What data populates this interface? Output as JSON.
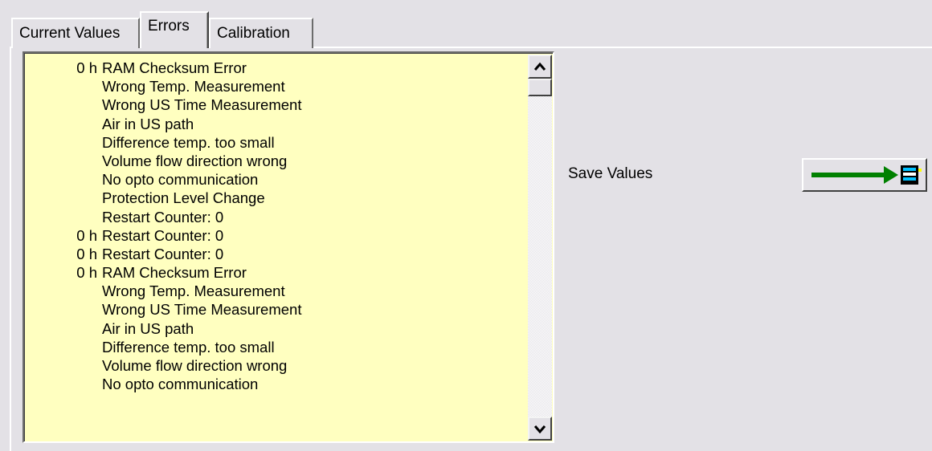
{
  "tabs": [
    {
      "label": "Current Values",
      "active": false
    },
    {
      "label": "Errors",
      "active": true
    },
    {
      "label": "Calibration",
      "active": false
    }
  ],
  "error_log": {
    "rows": [
      {
        "time": "0 h",
        "message": "RAM Checksum Error"
      },
      {
        "time": "",
        "message": "Wrong Temp. Measurement"
      },
      {
        "time": "",
        "message": "Wrong US Time Measurement"
      },
      {
        "time": "",
        "message": "Air in US path"
      },
      {
        "time": "",
        "message": "Difference temp. too small"
      },
      {
        "time": "",
        "message": "Volume flow direction wrong"
      },
      {
        "time": "",
        "message": "No opto communication"
      },
      {
        "time": "",
        "message": "Protection Level Change"
      },
      {
        "time": "",
        "message": "Restart Counter: 0"
      },
      {
        "time": "0 h",
        "message": "Restart Counter: 0"
      },
      {
        "time": "0 h",
        "message": "Restart Counter: 0"
      },
      {
        "time": "0 h",
        "message": "RAM Checksum Error"
      },
      {
        "time": "",
        "message": "Wrong Temp. Measurement"
      },
      {
        "time": "",
        "message": "Wrong US Time Measurement"
      },
      {
        "time": "",
        "message": "Air in US path"
      },
      {
        "time": "",
        "message": "Difference temp. too small"
      },
      {
        "time": "",
        "message": "Volume flow direction wrong"
      },
      {
        "time": "",
        "message": "No opto communication"
      }
    ],
    "background_color": "#ffffc0"
  },
  "save": {
    "label": "Save Values",
    "button_icon": "green-arrow-to-disk-icon",
    "arrow_color": "#008000"
  }
}
